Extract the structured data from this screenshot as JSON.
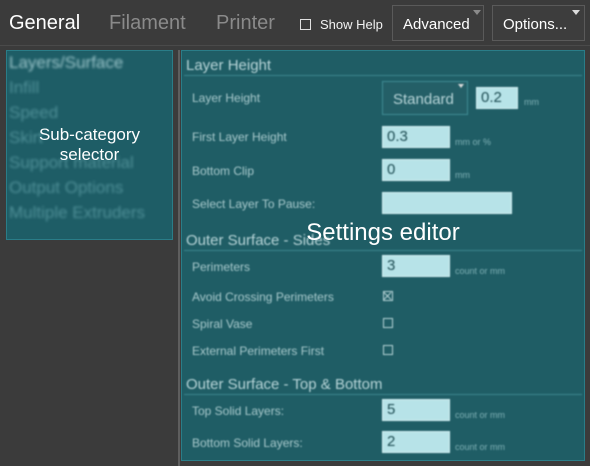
{
  "tabs": {
    "general": "General",
    "filament": "Filament",
    "printer": "Printer"
  },
  "show_help": {
    "label": "Show Help",
    "checked": false
  },
  "mode_dropdown": {
    "value": "Advanced"
  },
  "options_dropdown": {
    "label": "Options..."
  },
  "subcategories": [
    "Layers/Surface",
    "Infill",
    "Speed",
    "Skirt",
    "Support material",
    "Output Options",
    "Multiple Extruders"
  ],
  "subcategory_selected": "Layers/Surface",
  "sections": {
    "layer_height": {
      "title": "Layer Height",
      "layer_height_label": "Layer Height",
      "layer_height_preset": "Standard",
      "layer_height_value": "0.2",
      "layer_height_unit": "mm",
      "first_layer_label": "First Layer Height",
      "first_layer_value": "0.3",
      "first_layer_unit": "mm or %",
      "bottom_clip_label": "Bottom Clip",
      "bottom_clip_value": "0",
      "bottom_clip_unit": "mm",
      "pause_label": "Select Layer To Pause:",
      "pause_value": ""
    },
    "outer_surface": {
      "title": "Outer Surface - Sides",
      "perimeters_label": "Perimeters",
      "perimeters_value": "3",
      "perimeters_unit": "count or mm",
      "avoid_crossing_label": "Avoid Crossing Perimeters",
      "avoid_crossing_checked": true,
      "spiral_vase_label": "Spiral Vase",
      "spiral_vase_checked": false,
      "external_first_label": "External Perimeters First",
      "external_first_checked": false
    },
    "top_bottom": {
      "title": "Outer Surface - Top & Bottom",
      "top_label": "Top Solid Layers:",
      "top_value": "5",
      "top_unit": "count or mm",
      "bottom_label": "Bottom Solid Layers:",
      "bottom_value": "2",
      "bottom_unit": "count or mm"
    }
  },
  "overlays": {
    "subcategory_line1": "Sub-category",
    "subcategory_line2": "selector",
    "settings_editor": "Settings editor"
  }
}
